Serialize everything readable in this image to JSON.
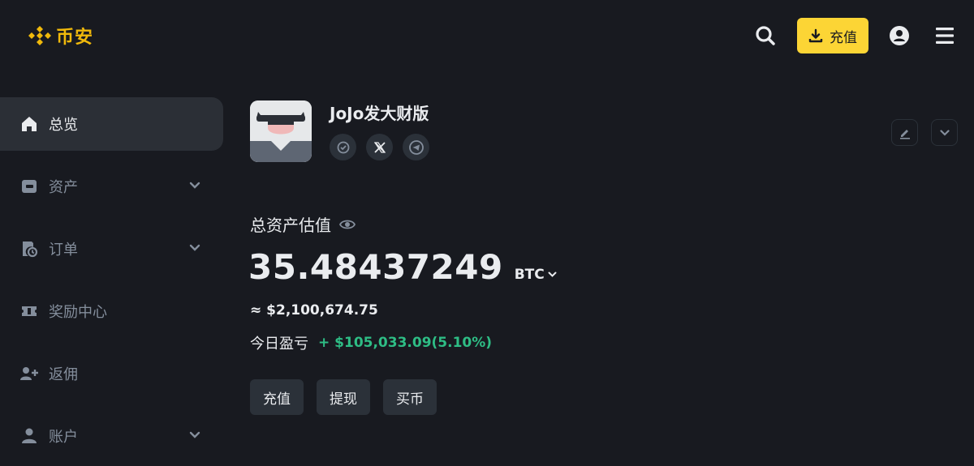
{
  "header": {
    "brand": "币安",
    "deposit_label": "充值",
    "accent_color": "#fcd535",
    "brand_color": "#f0b90b",
    "icons": [
      "search-icon",
      "download-icon",
      "user-icon",
      "menu-icon"
    ]
  },
  "sidebar": {
    "items": [
      {
        "label": "总览",
        "icon": "home-icon",
        "active": true,
        "expandable": false
      },
      {
        "label": "资产",
        "icon": "wallet-icon",
        "active": false,
        "expandable": true
      },
      {
        "label": "订单",
        "icon": "orders-icon",
        "active": false,
        "expandable": true
      },
      {
        "label": "奖励中心",
        "icon": "ticket-icon",
        "active": false,
        "expandable": false
      },
      {
        "label": "返佣",
        "icon": "add-user-icon",
        "active": false,
        "expandable": false
      },
      {
        "label": "账户",
        "icon": "person-icon",
        "active": false,
        "expandable": true
      }
    ]
  },
  "profile": {
    "name": "JoJo发大财版",
    "socials": [
      "verified-icon",
      "x-icon",
      "telegram-icon"
    ]
  },
  "overview": {
    "title": "总资产估值",
    "balance": "35.48437249",
    "unit": "BTC",
    "usd_value": "≈ $2,100,674.75",
    "pnl_label": "今日盈亏",
    "pnl_value": "+ $105,033.09(5.10%)",
    "positive_color": "#2ebd85"
  },
  "actions": {
    "deposit": "充值",
    "withdraw": "提现",
    "buy": "买币"
  }
}
